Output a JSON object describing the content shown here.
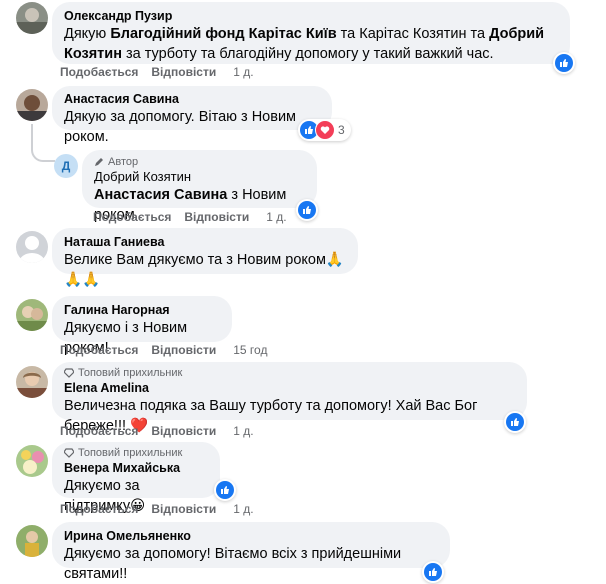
{
  "comments": [
    {
      "name": "Олександр Пузир",
      "segments": [
        {
          "text": "Дякую ",
          "bold": false
        },
        {
          "text": "Благодійний фонд Карітас Київ",
          "bold": true
        },
        {
          "text": " та Карітас Козятин та ",
          "bold": false
        },
        {
          "text": "Добрий Козятин",
          "bold": true
        },
        {
          "text": " за турботу та благодійну допомогу у такий важкий час.",
          "bold": false
        }
      ],
      "like_label": "Подобається",
      "reply_label": "Відповісти",
      "time": "1 д."
    },
    {
      "name": "Анастасия Савина",
      "text": "Дякую за допомогу. Вітаю з Новим роком.",
      "reaction_count": "3"
    },
    {
      "reply": true,
      "author_badge": "Автор",
      "name": "Добрий Козятин",
      "mention": "Анастасия Савина",
      "text": " з Новим роком",
      "avatar_letter": "Д",
      "like_label": "Подобається",
      "reply_label": "Відповісти",
      "time": "1 д."
    },
    {
      "name": "Наташа Ганиева",
      "text": "Велике Вам дякуємо та з Новим роком🙏🙏🙏"
    },
    {
      "name": "Галина Нагорная",
      "text": "Дякуємо і з Новим роком!",
      "like_label": "Подобається",
      "reply_label": "Відповісти",
      "time": "15 год"
    },
    {
      "top_fan": "Топовий прихильник",
      "name": "Elena Amelina",
      "text": "Величезна подяка за Вашу турботу та допомогу! Хай Вас Бог береже!!! ❤️",
      "like_label": "Подобається",
      "reply_label": "Відповісти",
      "time": "1 д."
    },
    {
      "top_fan": "Топовий прихильник",
      "name": "Венера Михайська",
      "text": "Дякуємо за підтримку😀",
      "like_label": "Подобається",
      "reply_label": "Відповісти",
      "time": "1 д."
    },
    {
      "name": "Ирина Омельяненко",
      "text": "Дякуємо за допомогу! Вітаємо всіх з прийдешніми святами!!"
    }
  ],
  "icons": {
    "like": "thumbs-up-icon",
    "heart": "heart-icon",
    "top_fan": "diamond-icon",
    "author": "pencil-icon"
  },
  "colors": {
    "like": "#1877f2",
    "heart": "#f33e58",
    "bubble": "#f0f2f5",
    "meta": "#65676b"
  }
}
